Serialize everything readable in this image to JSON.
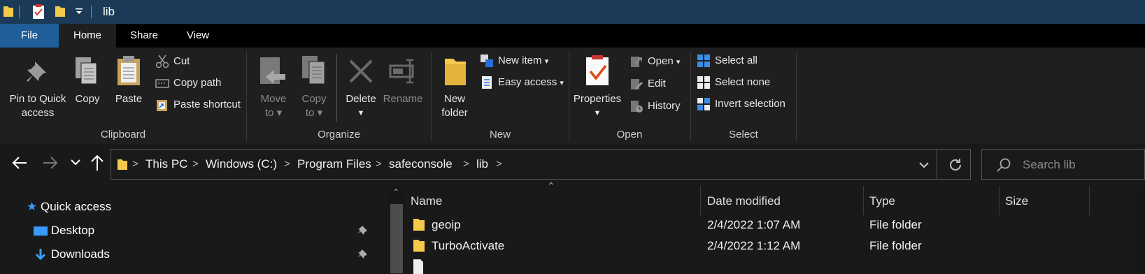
{
  "window": {
    "title": "lib"
  },
  "tabs": [
    {
      "label": "File"
    },
    {
      "label": "Home"
    },
    {
      "label": "Share"
    },
    {
      "label": "View"
    }
  ],
  "ribbon": {
    "clipboard": {
      "group_label": "Clipboard",
      "pin_line1": "Pin to Quick",
      "pin_line2": "access",
      "copy": "Copy",
      "paste": "Paste",
      "cut": "Cut",
      "copy_path": "Copy path",
      "paste_shortcut": "Paste shortcut"
    },
    "organize": {
      "group_label": "Organize",
      "move_line1": "Move",
      "move_line2": "to",
      "copy_line1": "Copy",
      "copy_line2": "to",
      "delete": "Delete",
      "rename": "Rename"
    },
    "new": {
      "group_label": "New",
      "new_folder_line1": "New",
      "new_folder_line2": "folder",
      "new_item": "New item",
      "easy_access": "Easy access"
    },
    "open": {
      "group_label": "Open",
      "properties": "Properties",
      "open": "Open",
      "edit": "Edit",
      "history": "History"
    },
    "select": {
      "group_label": "Select",
      "select_all": "Select all",
      "select_none": "Select none",
      "invert_selection": "Invert selection"
    }
  },
  "address": {
    "crumbs": [
      "This PC",
      "Windows (C:)",
      "Program Files",
      "safeconsole",
      "lib"
    ],
    "search_placeholder": "Search lib"
  },
  "nav_pane": {
    "items": [
      {
        "label": "Quick access"
      },
      {
        "label": "Desktop"
      },
      {
        "label": "Downloads"
      }
    ]
  },
  "file_list": {
    "columns": [
      "Name",
      "Date modified",
      "Type",
      "Size"
    ],
    "rows": [
      {
        "name": "geoip",
        "date": "2/4/2022 1:07 AM",
        "type": "File folder",
        "size": ""
      },
      {
        "name": "TurboActivate",
        "date": "2/4/2022 1:12 AM",
        "type": "File folder",
        "size": ""
      }
    ]
  },
  "colors": {
    "titlebar": "#1b3a57",
    "file_tab": "#1f5e99",
    "ribbon_bg": "#1f1f1f",
    "folder_yellow": "#f5c94a"
  }
}
